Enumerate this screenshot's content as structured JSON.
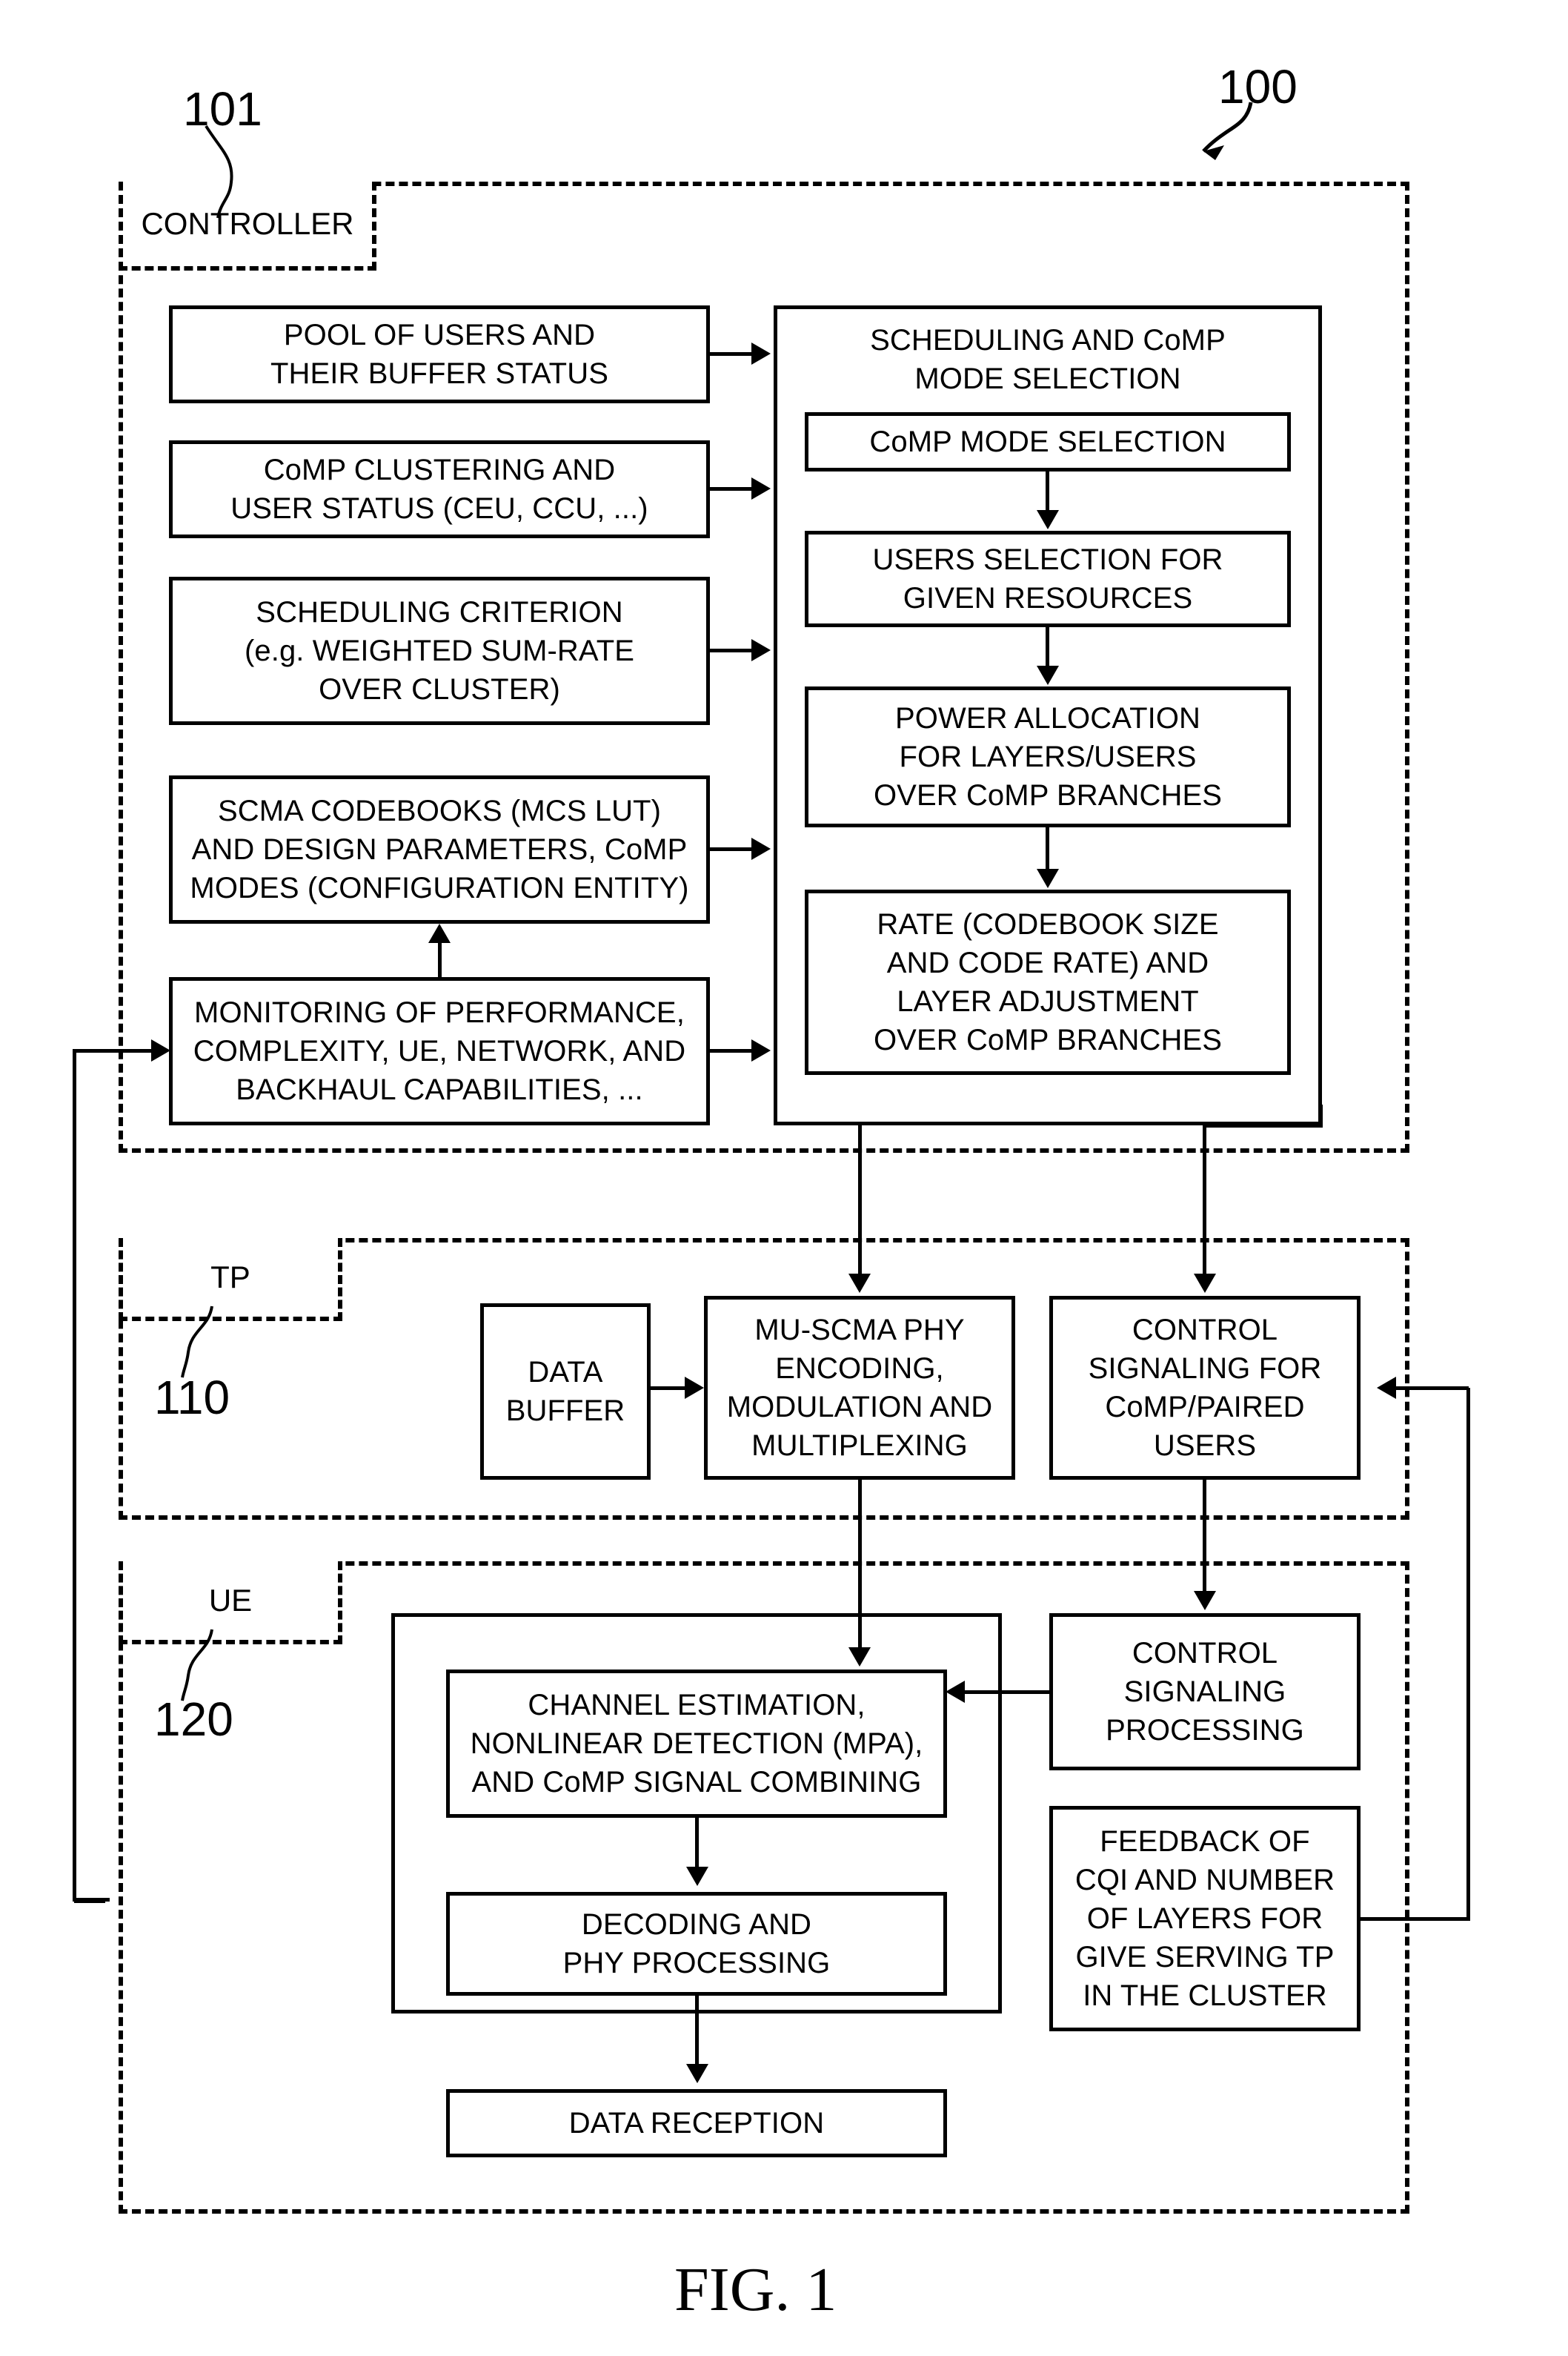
{
  "figure": {
    "caption": "FIG. 1",
    "system_ref": "100"
  },
  "sections": {
    "controller": {
      "tab_label": "CONTROLLER",
      "ref": "101"
    },
    "tp": {
      "tab_label": "TP",
      "ref": "110"
    },
    "ue": {
      "tab_label": "UE",
      "ref": "120"
    }
  },
  "controller_inputs": [
    {
      "id": "pool-of-users",
      "text": "POOL OF USERS AND\nTHEIR BUFFER STATUS"
    },
    {
      "id": "comp-clustering",
      "text": "CoMP CLUSTERING AND\nUSER STATUS (CEU, CCU, ...)"
    },
    {
      "id": "scheduling-criterion",
      "text": "SCHEDULING CRITERION\n(e.g. WEIGHTED SUM-RATE\nOVER CLUSTER)"
    },
    {
      "id": "scma-codebooks",
      "text": "SCMA CODEBOOKS (MCS LUT)\nAND DESIGN PARAMETERS, CoMP\nMODES (CONFIGURATION ENTITY)"
    },
    {
      "id": "monitoring",
      "text": "MONITORING OF PERFORMANCE,\nCOMPLEXITY, UE, NETWORK, AND\nBACKHAUL CAPABILITIES, ..."
    }
  ],
  "scheduling": {
    "title": "SCHEDULING AND CoMP\nMODE SELECTION",
    "steps": [
      {
        "id": "comp-mode-selection",
        "text": "CoMP MODE SELECTION"
      },
      {
        "id": "users-selection",
        "text": "USERS SELECTION FOR\nGIVEN RESOURCES"
      },
      {
        "id": "power-allocation",
        "text": "POWER ALLOCATION\nFOR LAYERS/USERS\nOVER CoMP BRANCHES"
      },
      {
        "id": "rate-layer-adjustment",
        "text": "RATE (CODEBOOK SIZE\nAND CODE RATE) AND\nLAYER ADJUSTMENT\nOVER CoMP BRANCHES"
      }
    ]
  },
  "tp_blocks": [
    {
      "id": "data-buffer",
      "text": "DATA\nBUFFER"
    },
    {
      "id": "mu-scma-phy",
      "text": "MU-SCMA PHY\nENCODING,\nMODULATION AND\nMULTIPLEXING"
    },
    {
      "id": "control-signaling-comp",
      "text": "CONTROL\nSIGNALING FOR\nCoMP/PAIRED\nUSERS"
    }
  ],
  "ue_blocks": [
    {
      "id": "channel-estimation",
      "text": "CHANNEL ESTIMATION,\nNONLINEAR DETECTION (MPA),\nAND CoMP SIGNAL COMBINING"
    },
    {
      "id": "decoding-phy",
      "text": "DECODING AND\nPHY PROCESSING"
    },
    {
      "id": "data-reception",
      "text": "DATA RECEPTION"
    },
    {
      "id": "control-signaling-processing",
      "text": "CONTROL\nSIGNALING\nPROCESSING"
    },
    {
      "id": "feedback-cqi",
      "text": "FEEDBACK OF\nCQI AND NUMBER\nOF LAYERS FOR\nGIVE SERVING TP\nIN THE CLUSTER"
    }
  ],
  "colors": {
    "ink": "#000000",
    "paper": "#ffffff"
  }
}
